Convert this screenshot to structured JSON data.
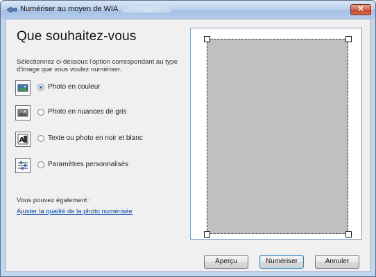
{
  "window": {
    "title": "Numériser au moyen de WIA",
    "close_label": "×"
  },
  "main": {
    "heading": "Que souhaitez-vous",
    "instructions": "Sélectionnez ci-dessous l'option correspondant au type d'image que vous voulez numériser.",
    "options": [
      {
        "label": "Photo en couleur",
        "icon": "color-photo-icon",
        "selected": true
      },
      {
        "label": "Photo en nuances de gris",
        "icon": "grayscale-photo-icon",
        "selected": false
      },
      {
        "label": "Texte ou photo en noir et blanc",
        "icon": "black-white-text-icon",
        "selected": false
      },
      {
        "label": "Paramètres personnalisés",
        "icon": "custom-settings-icon",
        "selected": false
      }
    ],
    "also_text": "Vous pouvez également :",
    "adjust_link": "Ajuster la qualité de la photo numérisée"
  },
  "buttons": {
    "preview": "Aperçu",
    "scan": "Numériser",
    "cancel": "Annuler"
  },
  "colors": {
    "title_gradient": "#b9d0ec",
    "close_red": "#c0462c",
    "link_blue": "#0645ad",
    "preview_gray": "#c0c0c0"
  }
}
